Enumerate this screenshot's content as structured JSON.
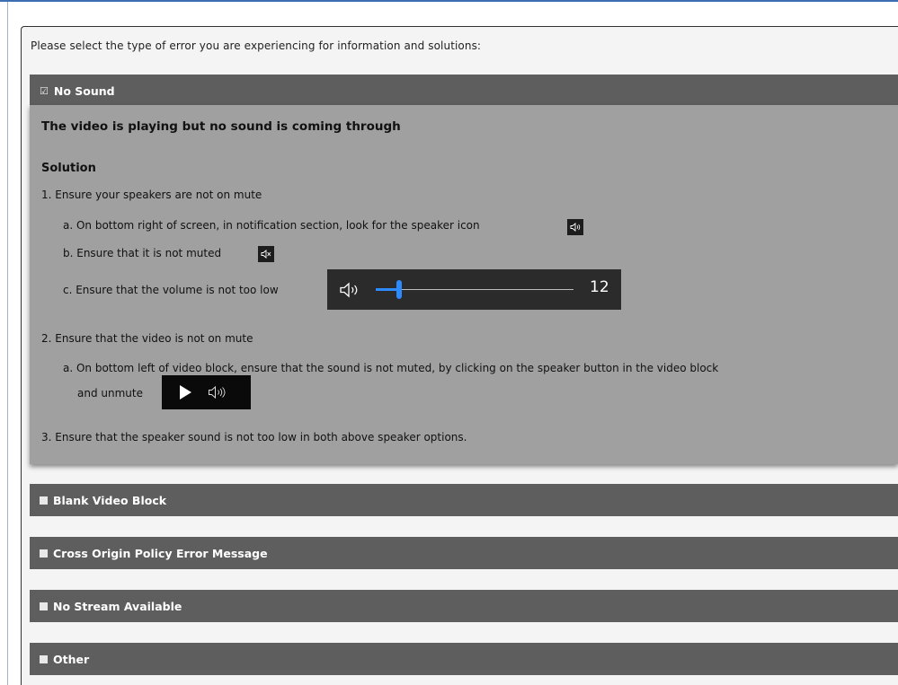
{
  "intro": "Please select the type of error you are experiencing for information and solutions:",
  "sections": [
    {
      "title": "No Sound",
      "expanded": true
    },
    {
      "title": "Blank Video Block",
      "expanded": false
    },
    {
      "title": "Cross Origin Policy Error Message",
      "expanded": false
    },
    {
      "title": "No Stream Available",
      "expanded": false
    },
    {
      "title": "Other",
      "expanded": false
    }
  ],
  "no_sound": {
    "subtitle": "The video is playing but no sound is coming through",
    "solution_heading": "Solution",
    "step1": "1. Ensure your speakers are not on mute",
    "step1a": "a. On bottom right of screen, in notification section, look for the speaker icon",
    "step1b": "b. Ensure that it is not muted",
    "step1c": "c. Ensure that the volume is not too low",
    "volume_value": "12",
    "volume_level_percent": 12,
    "step2": "2. Ensure that the video is not on mute",
    "step2a_line1": "a. On bottom left of video block, ensure that the sound is not muted, by clicking on the speaker button in the video block",
    "step2a_line2": "and unmute",
    "step3": "3. Ensure that the speaker sound is not too low in both above speaker options."
  },
  "icons": {
    "expanded_marker": "checked-box-icon",
    "collapsed_marker": "square-bullet-icon",
    "speaker": "speaker-icon",
    "speaker_muted": "speaker-muted-icon",
    "play": "play-icon"
  },
  "colors": {
    "header_bg": "#5e5e5e",
    "content_bg": "#a0a0a0",
    "volume_accent": "#2e8bff"
  }
}
